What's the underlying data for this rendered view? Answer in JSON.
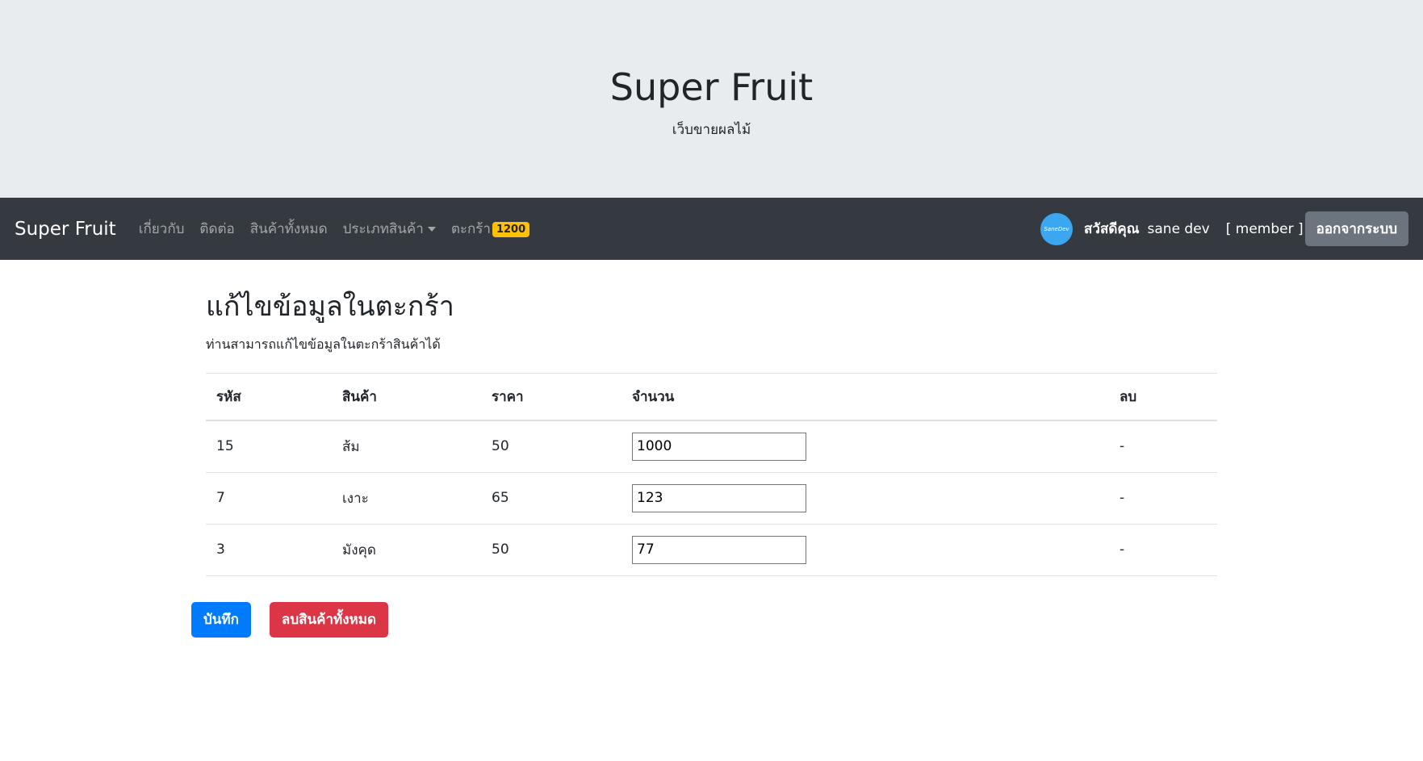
{
  "jumbotron": {
    "title": "Super Fruit",
    "subtitle": "เว็บขายผลไม้"
  },
  "navbar": {
    "brand": "Super Fruit",
    "links": [
      {
        "label": "เกี่ยวกับ"
      },
      {
        "label": "ติดต่อ"
      },
      {
        "label": "สินค้าทั้งหมด"
      },
      {
        "label": "ประเภทสินค้า"
      },
      {
        "label": "ตะกร้า",
        "badge": "1200"
      }
    ],
    "avatar_text": "SaneDev",
    "greeting": "สวัสดีคุณ",
    "username": "sane dev",
    "role": "[ member ]",
    "logout_label": "ออกจากระบบ"
  },
  "main": {
    "title": "แก้ไขข้อมูลในตะกร้า",
    "description": "ท่านสามารถแก้ไขข้อมูลในตะกร้าสินค้าได้",
    "columns": [
      "รหัส",
      "สินค้า",
      "ราคา",
      "จำนวน",
      "ลบ"
    ],
    "rows": [
      {
        "id": "15",
        "name": "ส้ม",
        "price": "50",
        "qty": "1000",
        "delete": "-"
      },
      {
        "id": "7",
        "name": "เงาะ",
        "price": "65",
        "qty": "123",
        "delete": "-"
      },
      {
        "id": "3",
        "name": "มังคุด",
        "price": "50",
        "qty": "77",
        "delete": "-"
      }
    ],
    "save_label": "บันทึก",
    "clear_label": "ลบสินค้าทั้งหมด"
  },
  "colors": {
    "jumbotron_bg": "#e9ecef",
    "navbar_bg": "#343a40",
    "badge": "#ffc107",
    "primary": "#007bff",
    "danger": "#dc3545",
    "secondary": "#6c757d"
  }
}
